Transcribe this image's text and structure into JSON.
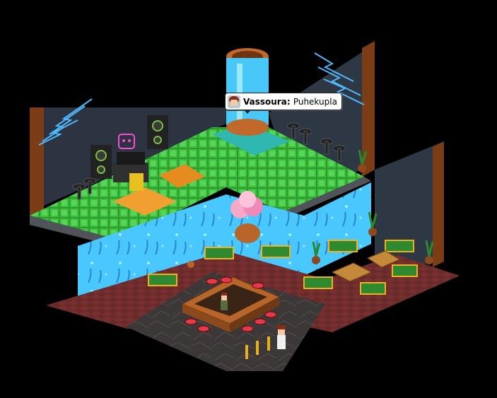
{
  "chat": {
    "speaker": "Vassoura",
    "message": "Puhekupla"
  },
  "scene": {
    "room_type": "isometric-pixel-nightclub",
    "areas": [
      "dj-stage",
      "dance-floor",
      "aquarium-wall",
      "bar",
      "lounge",
      "vip-entrance"
    ]
  },
  "colors": {
    "background": "#000000",
    "wall": "#2e3845",
    "floor_green": "#2e9a2e",
    "floor_tile_light": "#6fe06f",
    "floor_orange": "#f0a030",
    "aquarium": "#49c7ff",
    "carpet": "#6b2a2a",
    "marble": "#3a3636",
    "sofa": "#2f8a2f",
    "sofa_trim": "#f0b020",
    "bar_wood": "#b8652a",
    "neon_blue": "#4fb8ff",
    "neon_pink": "#ff4ad8"
  }
}
